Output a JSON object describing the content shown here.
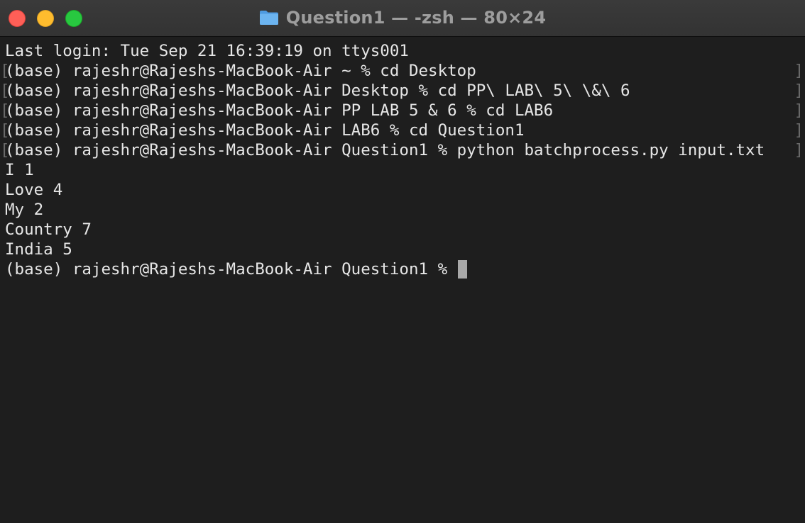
{
  "window": {
    "title": "Question1 — -zsh — 80×24",
    "title_icon": "folder-icon",
    "colors": {
      "background": "#1e1e1e",
      "text": "#e6e6e6",
      "titlebar": "#383838",
      "close": "#fe5f57",
      "minimize": "#febc2e",
      "zoom": "#28c840"
    }
  },
  "terminal": {
    "last_login": "Last login: Tue Sep 21 16:39:19 on ttys001",
    "commands": [
      "(base) rajeshr@Rajeshs-MacBook-Air ~ % cd Desktop",
      "(base) rajeshr@Rajeshs-MacBook-Air Desktop % cd PP\\ LAB\\ 5\\ \\&\\ 6",
      "(base) rajeshr@Rajeshs-MacBook-Air PP LAB 5 & 6 % cd LAB6",
      "(base) rajeshr@Rajeshs-MacBook-Air LAB6 % cd Question1",
      "(base) rajeshr@Rajeshs-MacBook-Air Question1 % python batchprocess.py input.txt"
    ],
    "output": [
      "I 1",
      "Love 4",
      "My 2",
      "Country 7",
      "India 5"
    ],
    "prompt": "(base) rajeshr@Rajeshs-MacBook-Air Question1 % "
  }
}
